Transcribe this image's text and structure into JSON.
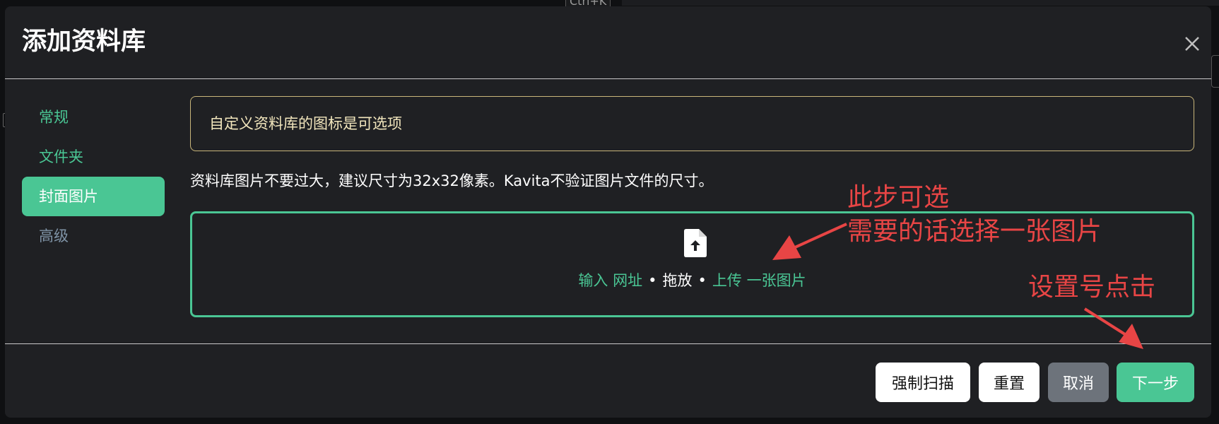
{
  "background": {
    "shortcut_hint": "Ctrl+K"
  },
  "modal": {
    "title": "添加资料库",
    "close_icon": "close-icon"
  },
  "nav": {
    "items": [
      {
        "label": "常规"
      },
      {
        "label": "文件夹"
      },
      {
        "label": "封面图片",
        "active": true
      },
      {
        "label": "高级"
      }
    ]
  },
  "content": {
    "alert": "自定义资料库的图标是可选项",
    "hint": "资料库图片不要过大，建议尺寸为32x32像素。Kavita不验证图片文件的尺寸。",
    "dropzone": {
      "icon": "file-upload-icon",
      "enter_label": "输入 网址",
      "separator": "•",
      "drag_label": "拖放",
      "upload_label": "上传 一张图片"
    }
  },
  "footer": {
    "force_scan": "强制扫描",
    "reset": "重置",
    "cancel": "取消",
    "next": "下一步"
  },
  "annotations": {
    "line1": "此步可选",
    "line2": "需要的话选择一张图片",
    "line3": "设置号点击"
  },
  "colors": {
    "accent": "#4ac694",
    "modal_bg": "#1f2023",
    "alert_border": "#c9b67a",
    "annotation": "#e84545"
  }
}
